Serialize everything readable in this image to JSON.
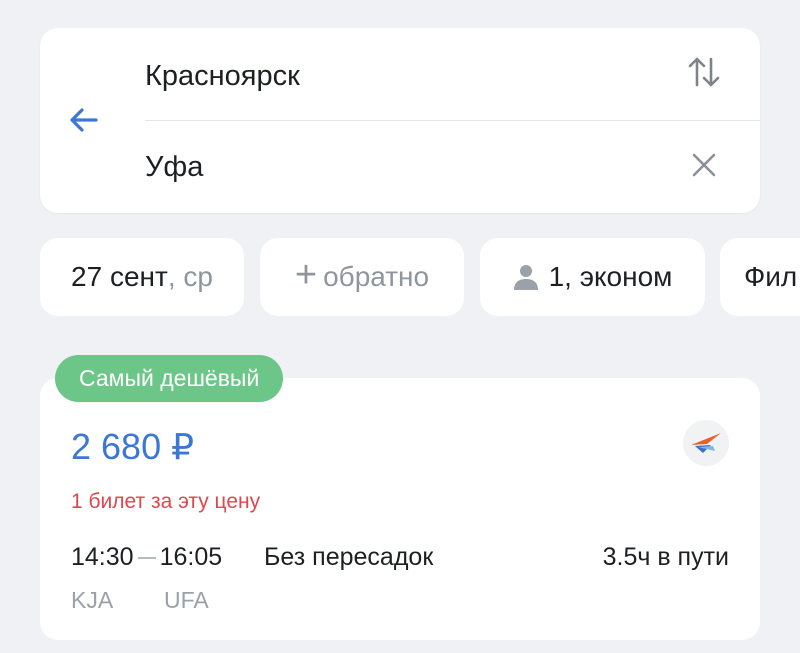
{
  "search": {
    "from_city": "Красноярск",
    "to_city": "Уфа",
    "back_icon": "arrow-left-icon",
    "swap_icon": "swap-vertical-icon",
    "clear_icon": "close-icon"
  },
  "chips": {
    "date_main": "27 сент",
    "date_weekday": ", ср",
    "return_plus": "+",
    "return_label": "обратно",
    "passengers_label": "1, эконом",
    "filters_label": "Фил"
  },
  "result": {
    "badge": "Самый дешёвый",
    "price": "2 680 ₽",
    "tickets_left": "1 билет за эту цену",
    "depart_time": "14:30",
    "arrive_time": "16:05",
    "transfers": "Без пересадок",
    "duration": "3.5ч в пути",
    "depart_code": "KJA",
    "arrive_code": "UFA"
  },
  "colors": {
    "accent": "#3c77d8",
    "badge": "#6cc687",
    "warning": "#e0474c",
    "background": "#eff1f4"
  }
}
